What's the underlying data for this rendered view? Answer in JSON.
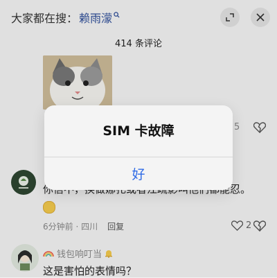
{
  "search": {
    "prefix": "大家都在搜：",
    "keyword": "赖雨濛",
    "icon": "search-icon"
  },
  "header": {
    "comment_count_label": "414 条评论"
  },
  "side_count": "5",
  "comment": {
    "text": "你信不，换做娜扎或者江疏影叫他们都能忍。",
    "meta": "6分钟前 · 四川",
    "reply_label": "回复",
    "likes": "2"
  },
  "comment2": {
    "user_name": "钱包响叮当",
    "text": "这是害怕的表情吗？"
  },
  "alert": {
    "title": "SIM 卡故障",
    "ok_label": "好"
  },
  "colors": {
    "accent": "#2f6be6",
    "keyword": "#2f4f9a",
    "background": "#f3f3f3"
  }
}
